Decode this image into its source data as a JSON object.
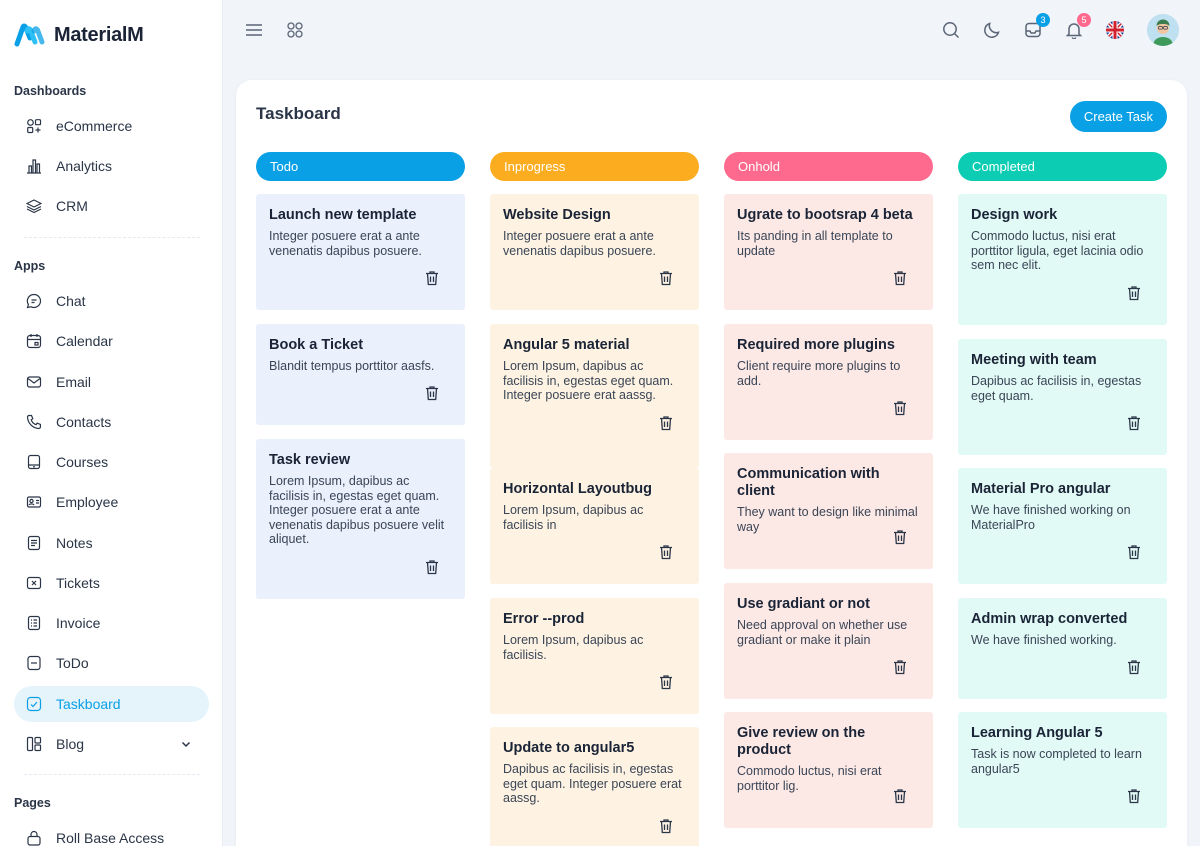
{
  "brand": {
    "name": "MaterialM"
  },
  "sidebar": {
    "sections": [
      "Dashboards",
      "Apps",
      "Pages"
    ],
    "dashboards": [
      {
        "label": "eCommerce",
        "icon": "grid-shapes-icon"
      },
      {
        "label": "Analytics",
        "icon": "bar-chart-icon"
      },
      {
        "label": "CRM",
        "icon": "layers-icon"
      }
    ],
    "apps": [
      {
        "label": "Chat",
        "icon": "chat-bubble-icon"
      },
      {
        "label": "Calendar",
        "icon": "calendar-icon"
      },
      {
        "label": "Email",
        "icon": "mail-icon"
      },
      {
        "label": "Contacts",
        "icon": "phone-icon"
      },
      {
        "label": "Courses",
        "icon": "tablet-icon"
      },
      {
        "label": "Employee",
        "icon": "id-card-icon"
      },
      {
        "label": "Notes",
        "icon": "note-icon"
      },
      {
        "label": "Tickets",
        "icon": "ticket-icon"
      },
      {
        "label": "Invoice",
        "icon": "list-doc-icon"
      },
      {
        "label": "ToDo",
        "icon": "todo-icon"
      },
      {
        "label": "Taskboard",
        "icon": "taskboard-icon",
        "active": true
      },
      {
        "label": "Blog",
        "icon": "blog-icon",
        "has_submenu": true
      }
    ],
    "pages": [
      {
        "label": "Roll Base Access",
        "icon": "lock-icon"
      }
    ]
  },
  "topbar": {
    "mail_badge": "3",
    "notification_badge": "5"
  },
  "board": {
    "title": "Taskboard",
    "create_label": "Create Task",
    "columns": [
      {
        "name": "Todo",
        "color": "#0aa0e6",
        "card_bg": "#eaf0fc",
        "tasks": [
          {
            "title": "Launch new template",
            "desc": "Integer posuere erat a ante venenatis dapibus posuere."
          },
          {
            "title": "Book a Ticket",
            "desc": "Blandit tempus porttitor aasfs."
          },
          {
            "title": "Task review",
            "desc": "Lorem Ipsum, dapibus ac facilisis in, egestas eget quam. Integer posuere erat a ante venenatis dapibus posuere velit aliquet."
          }
        ]
      },
      {
        "name": "Inprogress",
        "color": "#fbac1f",
        "card_bg": "#fef3e2",
        "tasks": [
          {
            "title": "Website Design",
            "desc": "Integer posuere erat a ante venenatis dapibus posuere."
          },
          {
            "title": "Angular 5 material",
            "desc": "Lorem Ipsum, dapibus ac facilisis in, egestas eget quam. Integer posuere erat aassg."
          },
          {
            "title": "Horizontal Layoutbug",
            "desc": "Lorem Ipsum, dapibus ac facilisis in"
          },
          {
            "title": "Error --prod",
            "desc": "Lorem Ipsum, dapibus ac facilisis."
          },
          {
            "title": "Update to angular5",
            "desc": "Dapibus ac facilisis in, egestas eget quam. Integer posuere erat aassg."
          }
        ]
      },
      {
        "name": "Onhold",
        "color": "#fd6a8e",
        "card_bg": "#fce9e6",
        "tasks": [
          {
            "title": "Ugrate to bootsrap 4 beta",
            "desc": "Its panding in all template to update"
          },
          {
            "title": "Required more plugins",
            "desc": "Client require more plugins to add."
          },
          {
            "title": "Communication with client",
            "desc": "They want to design like minimal way"
          },
          {
            "title": "Use gradiant or not",
            "desc": "Need approval on whether use gradiant or make it plain"
          },
          {
            "title": "Give review on the product",
            "desc": "Commodo luctus, nisi erat porttitor lig."
          }
        ]
      },
      {
        "name": "Completed",
        "color": "#0ccdb3",
        "card_bg": "#e2faf6",
        "tasks": [
          {
            "title": "Design work",
            "desc": "Commodo luctus, nisi erat porttitor ligula, eget lacinia odio sem nec elit."
          },
          {
            "title": "Meeting with team",
            "desc": "Dapibus ac facilisis in, egestas eget quam."
          },
          {
            "title": "Material Pro angular",
            "desc": "We have finished working on MaterialPro"
          },
          {
            "title": "Admin wrap converted",
            "desc": "We have finished working."
          },
          {
            "title": "Learning Angular 5",
            "desc": "Task is now completed to learn angular5"
          }
        ]
      }
    ]
  }
}
